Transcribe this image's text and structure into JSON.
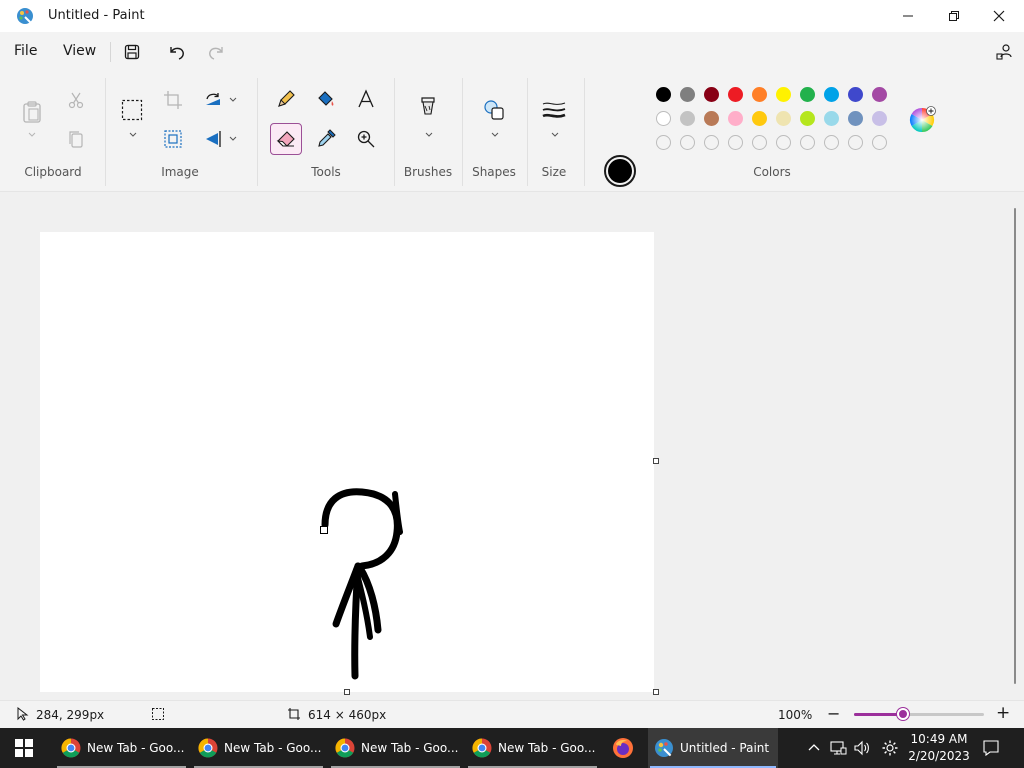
{
  "window": {
    "title": "Untitled - Paint"
  },
  "menu": {
    "file": "File",
    "view": "View"
  },
  "ribbon": {
    "groups": {
      "clipboard": "Clipboard",
      "image": "Image",
      "tools": "Tools",
      "brushes": "Brushes",
      "shapes": "Shapes",
      "size": "Size",
      "colors": "Colors"
    },
    "palette_row1": [
      "#000000",
      "#7f7f7f",
      "#880015",
      "#ed1c24",
      "#ff7f27",
      "#fff200",
      "#22b14c",
      "#00a2e8",
      "#3f48cc",
      "#a349a4"
    ],
    "palette_row2": [
      "#ffffff",
      "#c3c3c3",
      "#b97a57",
      "#ffaec9",
      "#ffc90e",
      "#efe4b0",
      "#b5e61d",
      "#99d9ea",
      "#7092be",
      "#c8bfe7"
    ],
    "primary_color": "#000000",
    "secondary_color": "#ffffff",
    "accent": "#9b2f9b"
  },
  "status": {
    "cursor_pos": "284, 299px",
    "canvas_size": "614 × 460px",
    "zoom": "100%",
    "zoom_level": 0.38
  },
  "taskbar": {
    "items": [
      {
        "label": "New Tab - Goo..."
      },
      {
        "label": "New Tab - Goo..."
      },
      {
        "label": "New Tab - Goo..."
      },
      {
        "label": "New Tab - Goo..."
      }
    ],
    "paint_label": "Untitled - Paint",
    "time": "10:49 AM",
    "date": "2/20/2023"
  }
}
